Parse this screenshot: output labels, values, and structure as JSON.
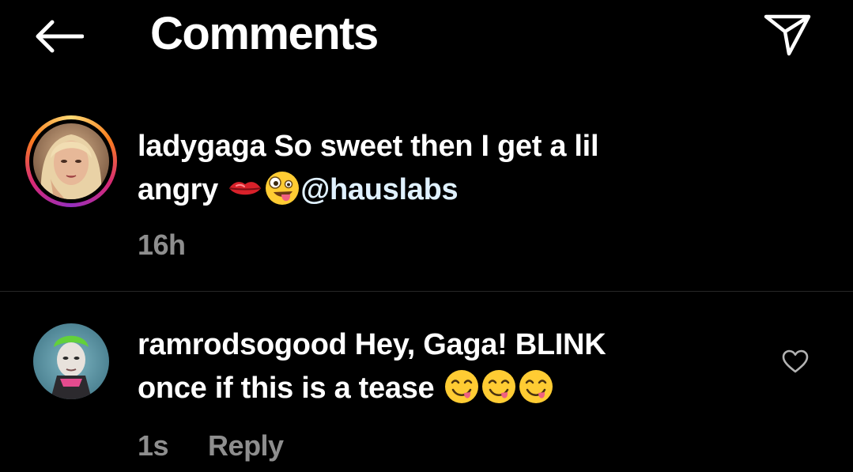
{
  "header": {
    "back_icon": "arrow-left-icon",
    "title": "Comments",
    "send_icon": "paper-plane-icon"
  },
  "comments": [
    {
      "username": "ladygaga",
      "text_line1": "So sweet then I get a lil",
      "text_line2": "angry",
      "emojis": [
        "lips-emoji",
        "zany-face-emoji"
      ],
      "mention": "@hauslabs",
      "time": "16h",
      "has_story_ring": true
    },
    {
      "username": "ramrodsogood",
      "text_line1": "Hey, Gaga! BLINK",
      "text_line2": "once if this is a tease",
      "emojis": [
        "yum-face-emoji",
        "yum-face-emoji",
        "yum-face-emoji"
      ],
      "time": "1s",
      "reply_label": "Reply",
      "like_icon": "heart-outline-icon"
    }
  ],
  "colors": {
    "background": "#000000",
    "text": "#ffffff",
    "secondary_text": "#8e8e8e",
    "mention": "#e0f1ff",
    "divider": "#262626"
  }
}
